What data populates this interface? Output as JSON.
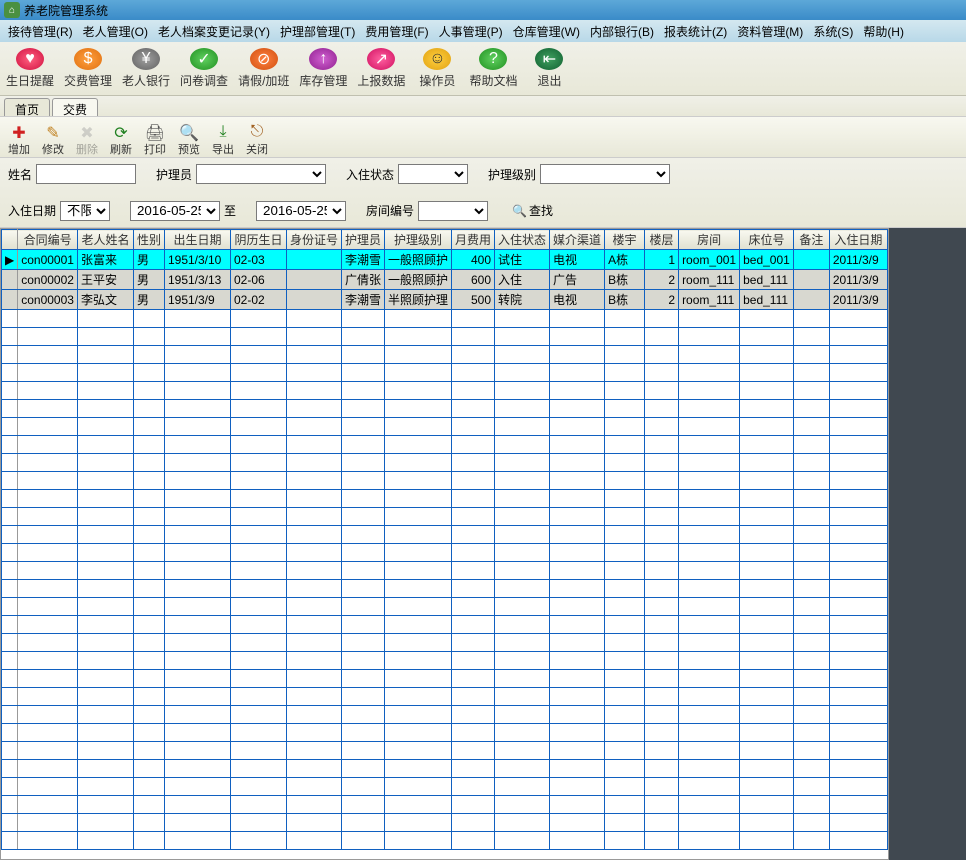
{
  "app": {
    "title": "养老院管理系统"
  },
  "menu": {
    "items": [
      "接待管理(R)",
      "老人管理(O)",
      "老人档案变更记录(Y)",
      "护理部管理(T)",
      "费用管理(F)",
      "人事管理(P)",
      "仓库管理(W)",
      "内部银行(B)",
      "报表统计(Z)",
      "资料管理(M)",
      "系统(S)",
      "帮助(H)"
    ]
  },
  "toolbar": {
    "items": [
      {
        "label": "生日提醒",
        "icon": "♥",
        "cls": "i-red"
      },
      {
        "label": "交费管理",
        "icon": "$",
        "cls": "i-orange"
      },
      {
        "label": "老人银行",
        "icon": "¥",
        "cls": "i-grey"
      },
      {
        "label": "问卷调查",
        "icon": "✓",
        "cls": "i-green"
      },
      {
        "label": "请假/加班",
        "icon": "⊘",
        "cls": "i-darkorange"
      },
      {
        "label": "库存管理",
        "icon": "↑",
        "cls": "i-purple"
      },
      {
        "label": "上报数据",
        "icon": "↗",
        "cls": "i-pink"
      },
      {
        "label": "操作员",
        "icon": "☺",
        "cls": "i-yellow"
      },
      {
        "label": "帮助文档",
        "icon": "?",
        "cls": "i-green"
      },
      {
        "label": "退出",
        "icon": "⇤",
        "cls": "i-darkgreen"
      }
    ]
  },
  "tabs": {
    "items": [
      "首页",
      "交费"
    ],
    "active": 1
  },
  "subtoolbar": {
    "items": [
      {
        "label": "增加",
        "icon": "✚",
        "color": "#d02020"
      },
      {
        "label": "修改",
        "icon": "✎",
        "color": "#c08020"
      },
      {
        "label": "删除",
        "icon": "✖",
        "color": "#999",
        "disabled": true
      },
      {
        "label": "刷新",
        "icon": "⟳",
        "color": "#208020"
      },
      {
        "label": "打印",
        "icon": "🖨",
        "color": "#555"
      },
      {
        "label": "预览",
        "icon": "🔍",
        "color": "#555"
      },
      {
        "label": "导出",
        "icon": "⤓",
        "color": "#208020"
      },
      {
        "label": "关闭",
        "icon": "⎋",
        "color": "#a06020"
      }
    ]
  },
  "filters": {
    "name_label": "姓名",
    "nurse_label": "护理员",
    "status_label": "入住状态",
    "level_label": "护理级别",
    "checkin_label": "入住日期",
    "checkin_limit": "不限",
    "date_from": "2016-05-25",
    "to": "至",
    "date_to": "2016-05-25",
    "room_label": "房间编号",
    "search": "查找"
  },
  "grid": {
    "headers": [
      "合同编号",
      "老人姓名",
      "性别",
      "出生日期",
      "阴历生日",
      "身份证号",
      "护理员",
      "护理级别",
      "月费用",
      "入住状态",
      "媒介渠道",
      "楼宇",
      "楼层",
      "房间",
      "床位号",
      "备注",
      "入住日期"
    ],
    "widths": [
      56,
      56,
      28,
      66,
      56,
      48,
      42,
      50,
      42,
      50,
      50,
      40,
      34,
      54,
      48,
      36,
      58
    ],
    "rows": [
      {
        "sel": true,
        "cells": [
          "con00001",
          "张富来",
          "男",
          "1951/3/10",
          "02-03",
          "",
          "李潮雪",
          "一般照顾护",
          "400",
          "试住",
          "电视",
          "A栋",
          "1",
          "room_001",
          "bed_001",
          "",
          "2011/3/9"
        ]
      },
      {
        "sel": false,
        "cells": [
          "con00002",
          "王平安",
          "男",
          "1951/3/13",
          "02-06",
          "",
          "广倩张",
          "一般照顾护",
          "600",
          "入住",
          "广告",
          "B栋",
          "2",
          "room_111",
          "bed_111",
          "",
          "2011/3/9"
        ]
      },
      {
        "sel": false,
        "cells": [
          "con00003",
          "李弘文",
          "男",
          "1951/3/9",
          "02-02",
          "",
          "李潮雪",
          "半照顾护理",
          "500",
          "转院",
          "电视",
          "B栋",
          "2",
          "room_111",
          "bed_111",
          "",
          "2011/3/9"
        ]
      }
    ],
    "num_cols": [
      8,
      12
    ],
    "empty_rows": 30
  }
}
